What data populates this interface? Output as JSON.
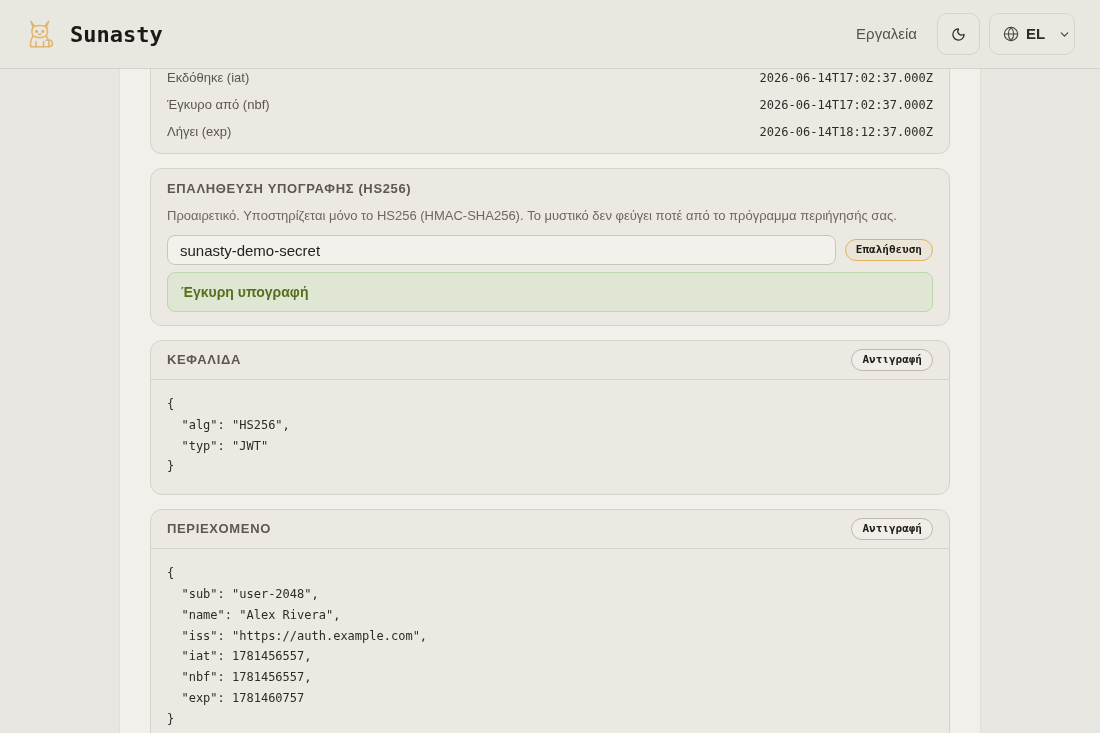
{
  "header": {
    "brand": "Sunasty",
    "nav": [
      {
        "label": "Εργαλεία"
      }
    ],
    "language": {
      "code": "EL"
    }
  },
  "claims": [
    {
      "label": "Εκδόθηκε (iat)",
      "value": "2026-06-14T17:02:37.000Z"
    },
    {
      "label": "Έγκυρο από (nbf)",
      "value": "2026-06-14T17:02:37.000Z"
    },
    {
      "label": "Λήγει (exp)",
      "value": "2026-06-14T18:12:37.000Z"
    }
  ],
  "signature": {
    "title": "ΕΠΑΛΗΘΕΥΣΗ ΥΠΟΓΡΑΦΗΣ (HS256)",
    "description": "Προαιρετικό. Υποστηρίζεται μόνο το HS256 (HMAC-SHA256). Το μυστικό δεν φεύγει ποτέ από το πρόγραμμα περιήγησής σας.",
    "secret": {
      "value": "sunasty-demo-secret"
    },
    "verify_button": "Επαλήθευση",
    "result": {
      "kind": "success",
      "message": "Έγκυρη υπογραφή"
    }
  },
  "sections": [
    {
      "title": "ΚΕΦΑΛΙΔΑ",
      "copy_button": "Αντιγραφή",
      "code_lines": [
        "{",
        "  \"alg\": \"HS256\",",
        "  \"typ\": \"JWT\"",
        "}"
      ]
    },
    {
      "title": "ΠΕΡΙΕΧΟΜΕΝΟ",
      "copy_button": "Αντιγραφή",
      "code_lines": [
        "{",
        "  \"sub\": \"user-2048\",",
        "  \"name\": \"Alex Rivera\",",
        "  \"iss\": \"https://auth.example.com\",",
        "  \"iat\": 1781456557,",
        "  \"nbf\": 1781456557,",
        "  \"exp\": 1781460757",
        "}"
      ]
    }
  ]
}
